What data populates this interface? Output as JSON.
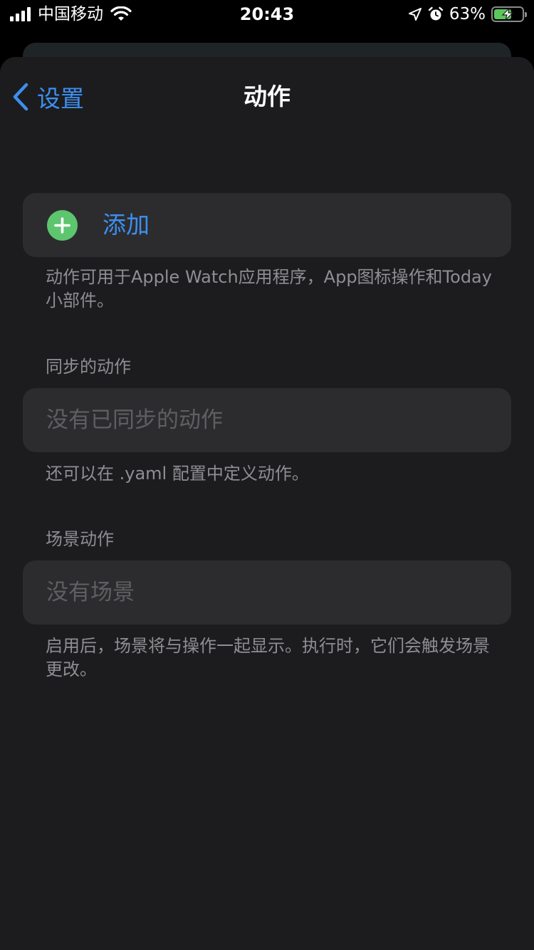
{
  "status": {
    "carrier": "中国移动",
    "time": "20:43",
    "battery_percent": "63%",
    "battery_level": 0.63,
    "battery_color": "#5ac75a",
    "icons": [
      "signal-bars-icon",
      "wifi-icon",
      "location-arrow-icon",
      "alarm-clock-icon",
      "battery-charging-icon"
    ]
  },
  "nav": {
    "back_label": "设置",
    "title": "动作"
  },
  "add": {
    "label": "添加",
    "icon": "plus-circle-icon",
    "footer": "动作可用于Apple Watch应用程序，App图标操作和Today小部件。"
  },
  "synced": {
    "header": "同步的动作",
    "placeholder": "没有已同步的动作",
    "footer": "还可以在 .yaml 配置中定义动作。"
  },
  "scenes": {
    "header": "场景动作",
    "placeholder": "没有场景",
    "footer": "启用后，场景将与操作一起显示。执行时，它们会触发场景更改。"
  },
  "colors": {
    "accent": "#3d8ff0",
    "add_green": "#5dc56e",
    "sheet_bg": "#1c1c1e",
    "cell_bg": "#2c2c2e",
    "secondary_text": "#8e8e93"
  }
}
